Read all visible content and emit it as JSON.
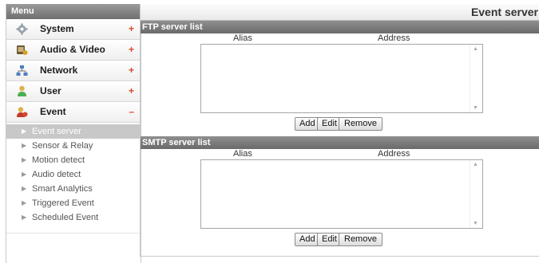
{
  "sidebar": {
    "header": "Menu",
    "items": [
      {
        "label": "System",
        "toggle": "+",
        "icon": "gear-icon"
      },
      {
        "label": "Audio & Video",
        "toggle": "+",
        "icon": "video-icon"
      },
      {
        "label": "Network",
        "toggle": "+",
        "icon": "network-icon"
      },
      {
        "label": "User",
        "toggle": "+",
        "icon": "user-icon"
      },
      {
        "label": "Event",
        "toggle": "–",
        "icon": "event-icon"
      }
    ],
    "submenu": [
      {
        "label": "Event server",
        "selected": true
      },
      {
        "label": "Sensor & Relay"
      },
      {
        "label": "Motion detect"
      },
      {
        "label": "Audio detect"
      },
      {
        "label": "Smart Analytics"
      },
      {
        "label": "Triggered Event"
      },
      {
        "label": "Scheduled Event"
      }
    ]
  },
  "main": {
    "title": "Event server",
    "ftp": {
      "header": "FTP server list",
      "col_alias": "Alias",
      "col_address": "Address",
      "buttons": {
        "add": "Add",
        "edit": "Edit",
        "remove": "Remove"
      }
    },
    "smtp": {
      "header": "SMTP server list",
      "col_alias": "Alias",
      "col_address": "Address",
      "buttons": {
        "add": "Add",
        "edit": "Edit",
        "remove": "Remove"
      }
    }
  },
  "colors": {
    "header_dark": "#6f6f6f",
    "toggle_accent": "#d44a2a",
    "selected_bg": "#c8c8c8"
  }
}
